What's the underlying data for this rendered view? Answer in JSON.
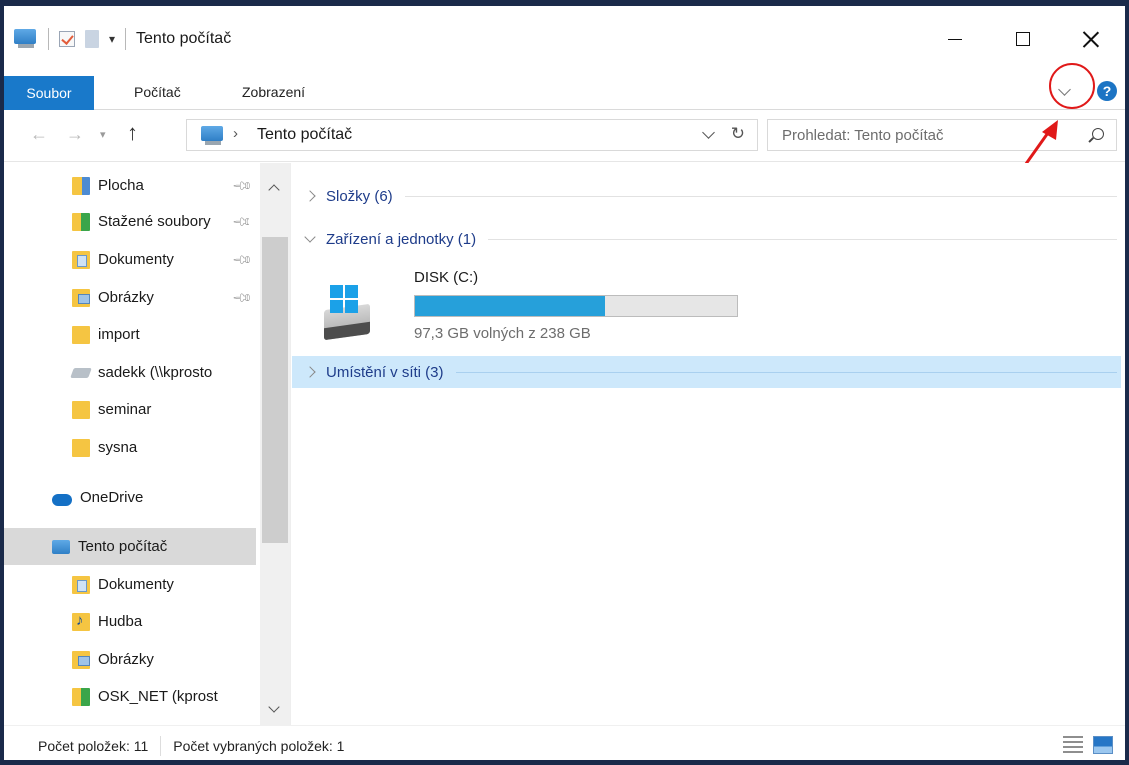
{
  "window": {
    "title": "Tento počítač",
    "controls": {
      "minimize": "—",
      "maximize": "☐",
      "close": "✕"
    }
  },
  "ribbon": {
    "tabs": [
      {
        "label": "Soubor",
        "active": true
      },
      {
        "label": "Počítač",
        "active": false
      },
      {
        "label": "Zobrazení",
        "active": false
      }
    ],
    "help": "?"
  },
  "address": {
    "path": "Tento počítač",
    "separator": "›",
    "search_placeholder": "Prohledat: Tento počítač"
  },
  "nav": {
    "items": [
      {
        "label": "Plocha",
        "icon": "desktop-folder-icon",
        "pinned": true
      },
      {
        "label": "Stažené soubory",
        "icon": "downloads-folder-icon",
        "pinned": true
      },
      {
        "label": "Dokumenty",
        "icon": "documents-folder-icon",
        "pinned": true
      },
      {
        "label": "Obrázky",
        "icon": "pictures-folder-icon",
        "pinned": true
      },
      {
        "label": "import",
        "icon": "folder-icon",
        "pinned": false
      },
      {
        "label": "sadekk (\\\\kprosto",
        "icon": "network-drive-icon",
        "pinned": false
      },
      {
        "label": "seminar",
        "icon": "folder-icon",
        "pinned": false
      },
      {
        "label": "sysna",
        "icon": "folder-icon",
        "pinned": false
      },
      {
        "label": "OneDrive",
        "icon": "onedrive-icon",
        "pinned": false
      },
      {
        "label": "Tento počítač",
        "icon": "this-pc-icon",
        "pinned": false,
        "selected": true
      },
      {
        "label": "Dokumenty",
        "icon": "documents-folder-icon",
        "pinned": false
      },
      {
        "label": "Hudba",
        "icon": "music-folder-icon",
        "pinned": false
      },
      {
        "label": "Obrázky",
        "icon": "pictures-folder-icon",
        "pinned": false
      },
      {
        "label": "OSK_NET (kprost",
        "icon": "network-drive-icon",
        "pinned": false
      }
    ]
  },
  "content": {
    "groups": [
      {
        "label": "Složky (6)",
        "expanded": false
      },
      {
        "label": "Zařízení a jednotky (1)",
        "expanded": true
      },
      {
        "label": "Umístění v síti (3)",
        "expanded": false,
        "highlighted": true
      }
    ],
    "drive": {
      "name": "DISK (C:)",
      "free_text": "97,3 GB volných z 238 GB",
      "used_fraction": 0.59
    }
  },
  "status": {
    "items_count": "Počet položek: 11",
    "selected_count": "Počet vybraných položek: 1"
  },
  "colors": {
    "accent": "#1979ca",
    "group_header": "#1e3c8a",
    "usage_fill": "#26a0da",
    "annotation": "#e01919"
  }
}
